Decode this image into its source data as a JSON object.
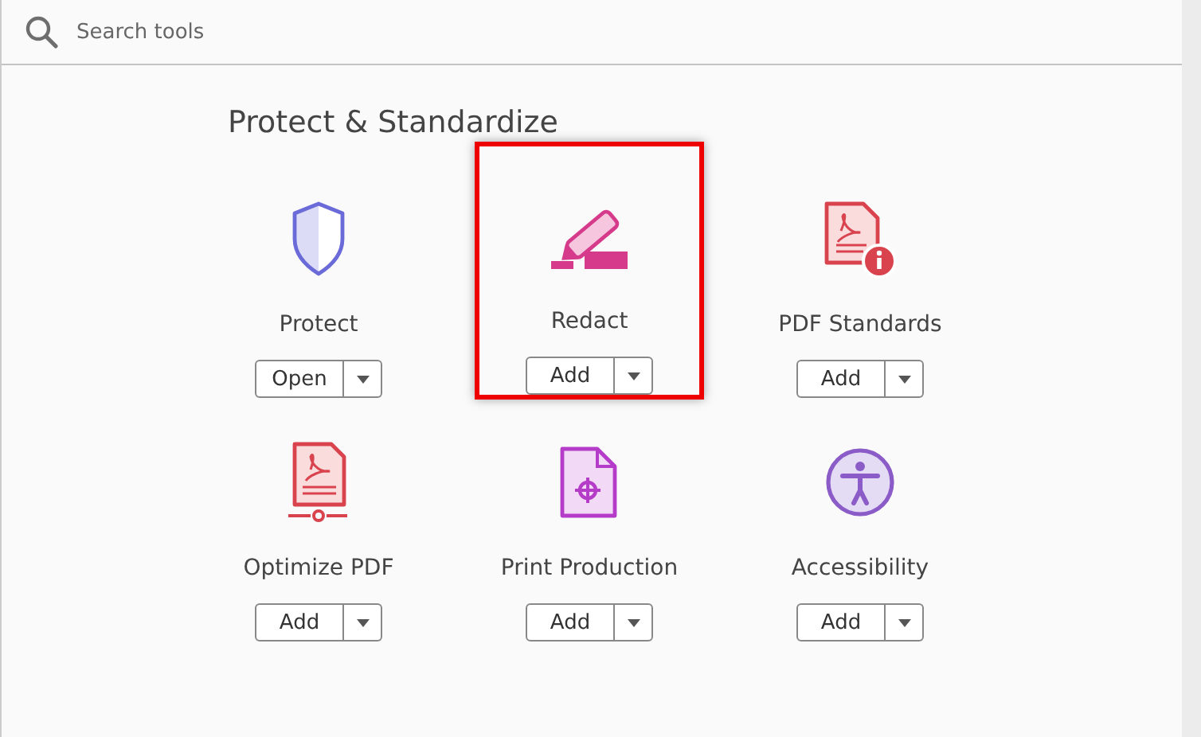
{
  "search": {
    "placeholder": "Search tools"
  },
  "section": {
    "title": "Protect & Standardize"
  },
  "tools": [
    {
      "kind": "shield",
      "label": "Protect",
      "action": "Open",
      "highlighted": false
    },
    {
      "kind": "marker",
      "label": "Redact",
      "action": "Add",
      "highlighted": true
    },
    {
      "kind": "pdf-info",
      "label": "PDF Standards",
      "action": "Add",
      "highlighted": false
    },
    {
      "kind": "pdf-slider",
      "label": "Optimize PDF",
      "action": "Add",
      "highlighted": false
    },
    {
      "kind": "crosshair-doc",
      "label": "Print Production",
      "action": "Add",
      "highlighted": false
    },
    {
      "kind": "person-circle",
      "label": "Accessibility",
      "action": "Add",
      "highlighted": false
    }
  ]
}
